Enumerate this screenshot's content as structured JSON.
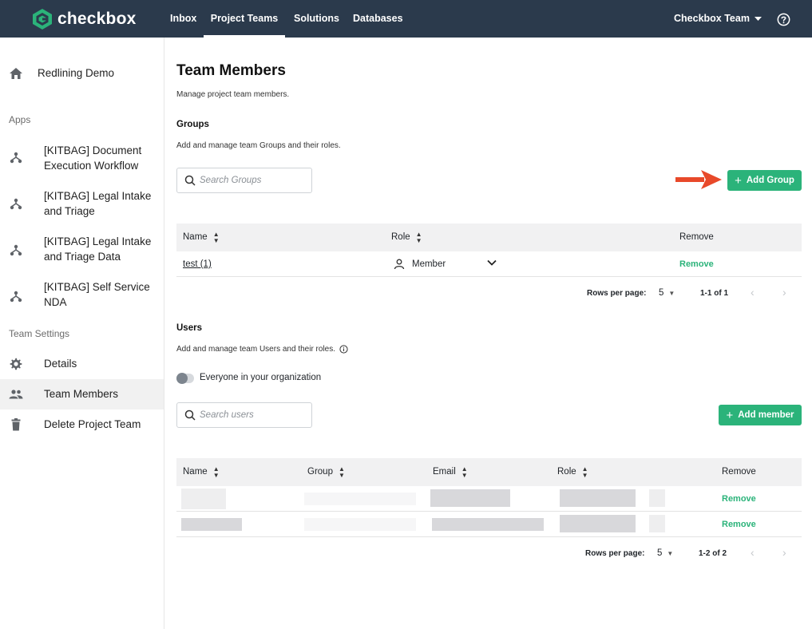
{
  "topbar": {
    "logo_text": "checkbox",
    "nav": [
      {
        "label": "Inbox"
      },
      {
        "label": "Project Teams",
        "active": true
      },
      {
        "label": "Solutions"
      },
      {
        "label": "Databases"
      }
    ],
    "team_select": "Checkbox Team",
    "help_icon": "question-circle-icon",
    "bg_color": "#2b3a4c"
  },
  "sidebar": {
    "project": "Redlining Demo",
    "apps_heading": "Apps",
    "apps": [
      {
        "label": "[KITBAG] Document Execution Workflow"
      },
      {
        "label": "[KITBAG] Legal Intake and Triage"
      },
      {
        "label": "[KITBAG] Legal Intake and Triage Data"
      },
      {
        "label": "[KITBAG] Self Service NDA"
      }
    ],
    "settings_heading": "Team Settings",
    "settings": [
      {
        "label": "Details",
        "icon": "gear-icon"
      },
      {
        "label": "Team Members",
        "icon": "people-icon",
        "active": true
      },
      {
        "label": "Delete Project Team",
        "icon": "trash-icon"
      }
    ]
  },
  "page": {
    "title": "Team Members",
    "subtitle": "Manage project team members."
  },
  "groups": {
    "heading": "Groups",
    "description": "Add and manage team Groups and their roles.",
    "search_placeholder": "Search Groups",
    "add_button": "Add Group",
    "columns": {
      "name": "Name",
      "role": "Role",
      "remove": "Remove"
    },
    "rows": [
      {
        "name": "test (1)",
        "role": "Member",
        "remove": "Remove"
      }
    ],
    "pagination": {
      "rows_per_page_label": "Rows per page:",
      "rows_per_page": "5",
      "range": "1-1 of 1"
    }
  },
  "users": {
    "heading": "Users",
    "description": "Add and manage team Users and their roles.",
    "toggle_label": "Everyone in your organization",
    "search_placeholder": "Search users",
    "add_button": "Add member",
    "columns": {
      "name": "Name",
      "group": "Group",
      "email": "Email",
      "role": "Role",
      "remove": "Remove"
    },
    "rows": [
      {
        "remove": "Remove"
      },
      {
        "remove": "Remove"
      }
    ],
    "pagination": {
      "rows_per_page_label": "Rows per page:",
      "rows_per_page": "5",
      "range": "1-2 of 2"
    }
  },
  "colors": {
    "accent_green": "#2bb37a",
    "arrow_red": "#e8492a"
  }
}
